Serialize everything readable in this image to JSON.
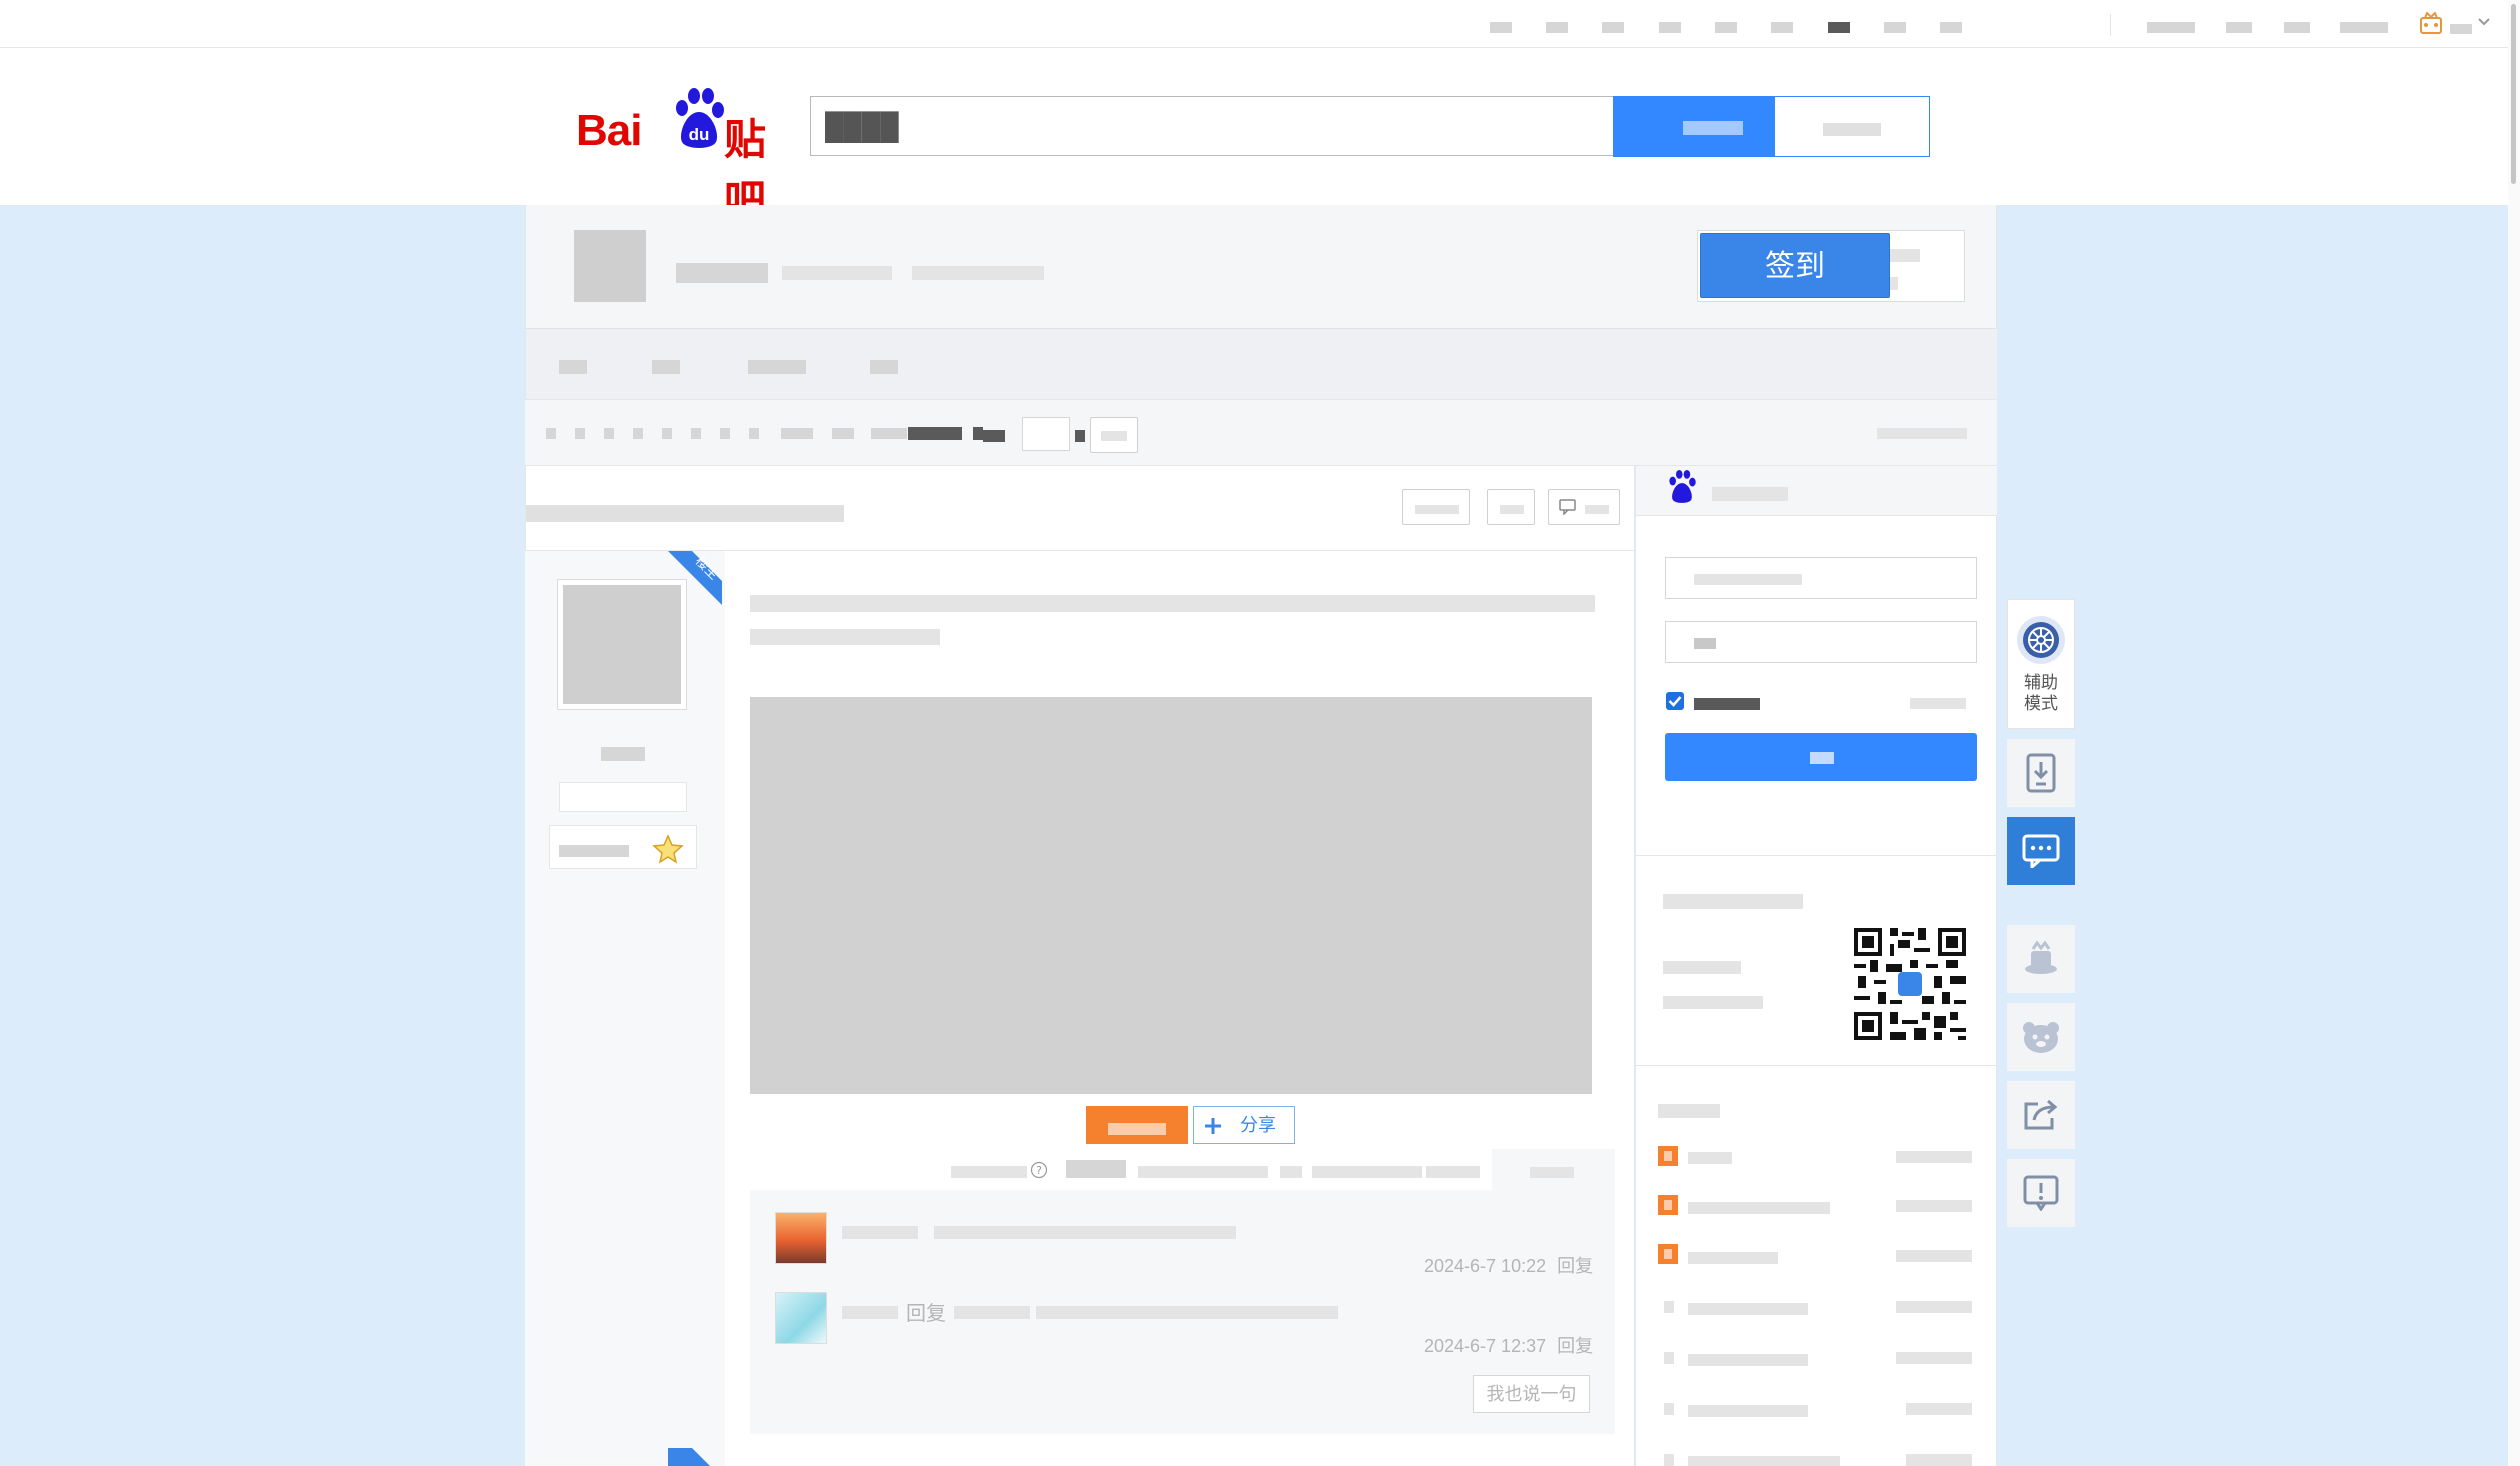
{
  "header": {
    "search_value": "████",
    "logo": {
      "bai": "Bai",
      "du": "du",
      "tieba": "贴吧"
    }
  },
  "forum": {
    "signin_label": "签到"
  },
  "post": {
    "share_label": "分享",
    "badge_label": "楼主",
    "help_glyph": "?"
  },
  "replies": [
    {
      "time": "2024-6-7 10:22",
      "reply_label": "回复"
    },
    {
      "prefix": "回复",
      "time": "2024-6-7 12:37",
      "reply_label": "回复"
    }
  ],
  "reply_box": {
    "label": "我也说一句"
  },
  "side_tools": {
    "assist_label_1": "辅助",
    "assist_label_2": "模式"
  },
  "colors": {
    "brand_blue": "#3388ff",
    "brand_red": "#e10601",
    "orange": "#f5802d",
    "page_bg": "#ddecfb"
  }
}
